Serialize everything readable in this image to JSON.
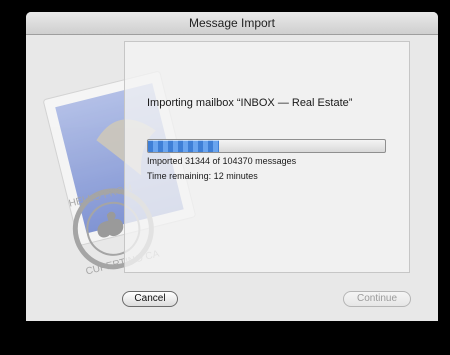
{
  "window": {
    "title": "Message Import"
  },
  "import": {
    "heading": "Importing mailbox “INBOX — Real Estate”",
    "progress_fraction": 0.3,
    "progress_text": "Imported 31344 of 104370 messages",
    "time_remaining": "Time remaining: 12 minutes"
  },
  "buttons": {
    "cancel": "Cancel",
    "continue": "Continue"
  },
  "stamp": {
    "text_top": "HELLO FROM",
    "text_bottom": "CUPERTINO CA"
  }
}
